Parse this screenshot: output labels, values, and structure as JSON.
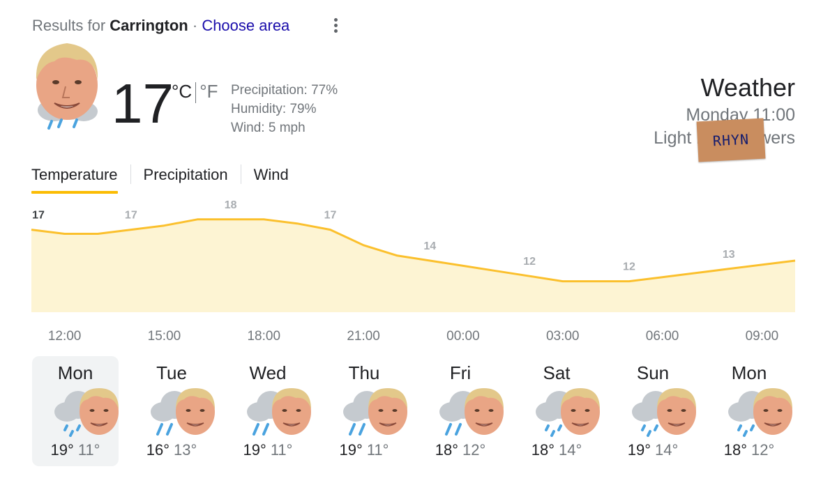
{
  "header": {
    "results_prefix": "Results for",
    "location": "Carrington",
    "separator": "·",
    "choose_area": "Choose area",
    "more_icon": "more-vert-icon"
  },
  "current": {
    "temperature": "17",
    "unit_c": "°C",
    "unit_f": "°F",
    "precipitation": "Precipitation: 77%",
    "humidity": "Humidity: 79%",
    "wind": "Wind: 5 mph",
    "icon": "rain-showers-icon"
  },
  "summary": {
    "title": "Weather",
    "time": "Monday 11:00",
    "condition": "Light rain showers",
    "sticker_text": "RHYN"
  },
  "tabs": [
    "Temperature",
    "Precipitation",
    "Wind"
  ],
  "active_tab": 0,
  "chart_data": {
    "type": "area",
    "x": [
      "11:00",
      "12:00",
      "13:00",
      "14:00",
      "15:00",
      "16:00",
      "17:00",
      "18:00",
      "19:00",
      "20:00",
      "21:00",
      "22:00",
      "23:00",
      "00:00",
      "01:00",
      "02:00",
      "03:00",
      "04:00",
      "05:00",
      "06:00",
      "07:00",
      "08:00",
      "09:00",
      "10:00"
    ],
    "values": [
      17,
      16.6,
      16.6,
      17,
      17.4,
      18,
      18,
      18,
      17.6,
      17,
      15.5,
      14.5,
      14,
      13.5,
      13,
      12.5,
      12,
      12,
      12,
      12.4,
      12.8,
      13.2,
      13.6,
      14
    ],
    "point_labels": [
      {
        "x": "11:00",
        "label": "17",
        "current": true
      },
      {
        "x": "14:00",
        "label": "17"
      },
      {
        "x": "17:00",
        "label": "18"
      },
      {
        "x": "20:00",
        "label": "17"
      },
      {
        "x": "23:00",
        "label": "14"
      },
      {
        "x": "02:00",
        "label": "12"
      },
      {
        "x": "05:00",
        "label": "12"
      },
      {
        "x": "08:00",
        "label": "13"
      }
    ],
    "x_ticks": [
      "12:00",
      "15:00",
      "18:00",
      "21:00",
      "00:00",
      "03:00",
      "06:00",
      "09:00"
    ],
    "ylim": [
      9,
      19
    ],
    "line_color": "#fbc02d",
    "fill_color": "#fdf4d3",
    "grid": false
  },
  "days": [
    {
      "name": "Mon",
      "hi": "19°",
      "lo": "11°",
      "icon": "rain-showers-icon",
      "selected": true
    },
    {
      "name": "Tue",
      "hi": "16°",
      "lo": "13°",
      "icon": "rain-icon"
    },
    {
      "name": "Wed",
      "hi": "19°",
      "lo": "11°",
      "icon": "rain-icon"
    },
    {
      "name": "Thu",
      "hi": "19°",
      "lo": "11°",
      "icon": "rain-icon"
    },
    {
      "name": "Fri",
      "hi": "18°",
      "lo": "12°",
      "icon": "rain-icon"
    },
    {
      "name": "Sat",
      "hi": "18°",
      "lo": "14°",
      "icon": "rain-showers-icon"
    },
    {
      "name": "Sun",
      "hi": "19°",
      "lo": "14°",
      "icon": "rain-showers-icon"
    },
    {
      "name": "Mon",
      "hi": "18°",
      "lo": "12°",
      "icon": "rain-showers-icon"
    }
  ],
  "colors": {
    "accent": "#fbbc04",
    "link": "#1a0dab",
    "muted": "#70757a",
    "rain": "#4aa3df",
    "cloud": "#c5cacf"
  }
}
